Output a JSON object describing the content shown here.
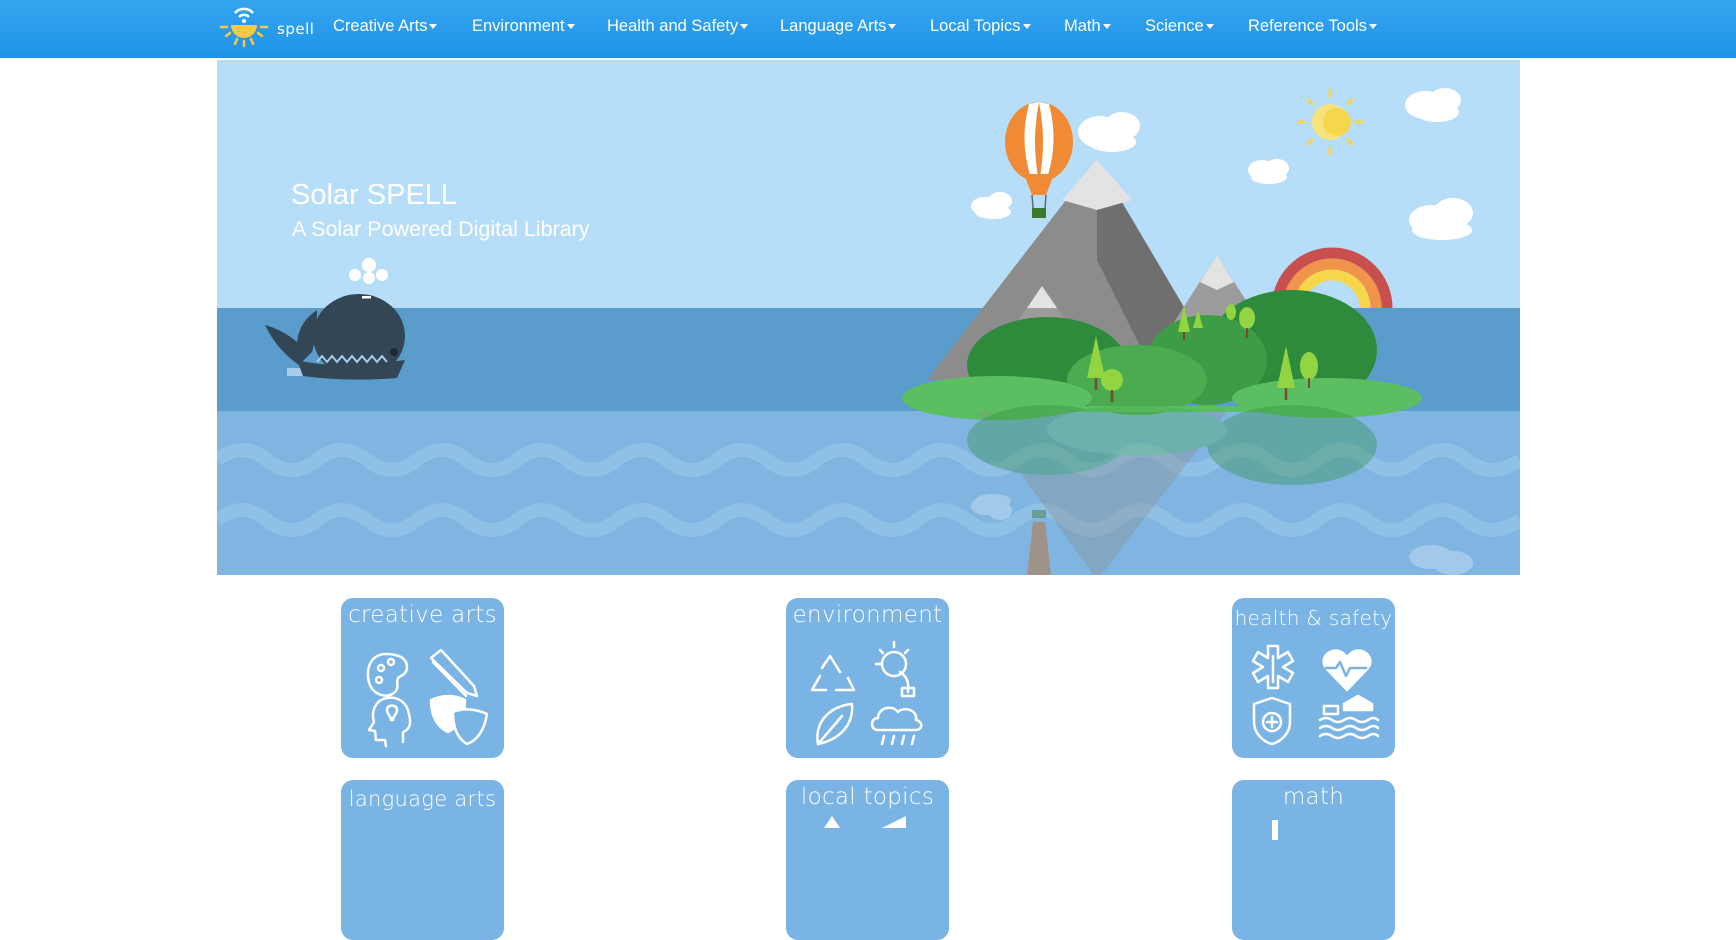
{
  "brand": {
    "name": "spell"
  },
  "nav": {
    "items": [
      {
        "label": "Creative Arts"
      },
      {
        "label": "Environment"
      },
      {
        "label": "Health and Safety"
      },
      {
        "label": "Language Arts"
      },
      {
        "label": "Local Topics"
      },
      {
        "label": "Math"
      },
      {
        "label": "Science"
      },
      {
        "label": "Reference Tools"
      }
    ]
  },
  "hero": {
    "title": "Solar SPELL",
    "subtitle": "A Solar Powered Digital Library"
  },
  "tiles": [
    {
      "label": "creative arts",
      "icons": [
        "palette-icon",
        "pencil-icon",
        "idea-head-icon",
        "theater-masks-icon"
      ]
    },
    {
      "label": "environment",
      "icons": [
        "recycle-icon",
        "solar-plug-icon",
        "leaf-icon",
        "rain-cloud-icon"
      ]
    },
    {
      "label": "health & safety",
      "icons": [
        "medical-star-icon",
        "heartbeat-icon",
        "shield-cross-icon",
        "flood-house-icon"
      ]
    },
    {
      "label": "language arts",
      "icons": []
    },
    {
      "label": "local topics",
      "icons": []
    },
    {
      "label": "math",
      "icons": []
    }
  ],
  "colors": {
    "navbar": "#1e93e6",
    "tile": "#7ab4e4",
    "sky": "#b7def9",
    "sea": "#5a9ccb"
  }
}
